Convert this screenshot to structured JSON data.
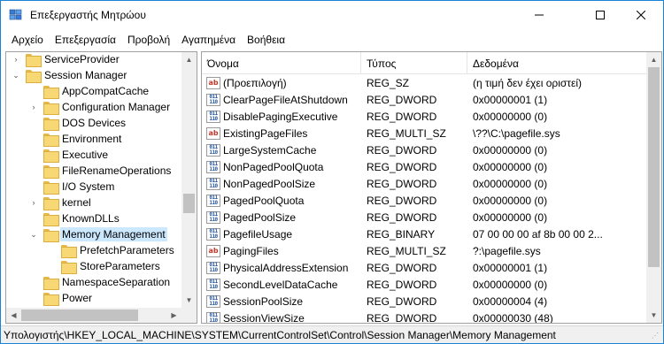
{
  "window": {
    "title": "Επεξεργαστής Μητρώου"
  },
  "menu": [
    "Αρχείο",
    "Επεξεργασία",
    "Προβολή",
    "Αγαπημένα",
    "Βοήθεια"
  ],
  "tree": {
    "items": [
      {
        "label": "ServiceProvider",
        "expander": "›",
        "indent": 1
      },
      {
        "label": "Session Manager",
        "expander": "⌄",
        "indent": 1
      },
      {
        "label": "AppCompatCache",
        "expander": "",
        "indent": 2
      },
      {
        "label": "Configuration Manager",
        "expander": "›",
        "indent": 2
      },
      {
        "label": "DOS Devices",
        "expander": "",
        "indent": 2
      },
      {
        "label": "Environment",
        "expander": "",
        "indent": 2
      },
      {
        "label": "Executive",
        "expander": "",
        "indent": 2
      },
      {
        "label": "FileRenameOperations",
        "expander": "",
        "indent": 2
      },
      {
        "label": "I/O System",
        "expander": "",
        "indent": 2
      },
      {
        "label": "kernel",
        "expander": "›",
        "indent": 2
      },
      {
        "label": "KnownDLLs",
        "expander": "",
        "indent": 2
      },
      {
        "label": "Memory Management",
        "expander": "⌄",
        "indent": 2,
        "selected": true
      },
      {
        "label": "PrefetchParameters",
        "expander": "",
        "indent": 3
      },
      {
        "label": "StoreParameters",
        "expander": "",
        "indent": 3
      },
      {
        "label": "NamespaceSeparation",
        "expander": "",
        "indent": 2
      },
      {
        "label": "Power",
        "expander": "",
        "indent": 2
      }
    ]
  },
  "values": {
    "columns": {
      "name": "Όνομα",
      "type": "Τύπος",
      "data": "Δεδομένα"
    },
    "rows": [
      {
        "icon": "string-value-icon",
        "name": "(Προεπιλογή)",
        "type": "REG_SZ",
        "data": "(η τιμή δεν έχει οριστεί)"
      },
      {
        "icon": "binary-value-icon",
        "name": "ClearPageFileAtShutdown",
        "type": "REG_DWORD",
        "data": "0x00000001 (1)"
      },
      {
        "icon": "binary-value-icon",
        "name": "DisablePagingExecutive",
        "type": "REG_DWORD",
        "data": "0x00000000 (0)"
      },
      {
        "icon": "string-value-icon",
        "name": "ExistingPageFiles",
        "type": "REG_MULTI_SZ",
        "data": "\\??\\C:\\pagefile.sys"
      },
      {
        "icon": "binary-value-icon",
        "name": "LargeSystemCache",
        "type": "REG_DWORD",
        "data": "0x00000000 (0)"
      },
      {
        "icon": "binary-value-icon",
        "name": "NonPagedPoolQuota",
        "type": "REG_DWORD",
        "data": "0x00000000 (0)"
      },
      {
        "icon": "binary-value-icon",
        "name": "NonPagedPoolSize",
        "type": "REG_DWORD",
        "data": "0x00000000 (0)"
      },
      {
        "icon": "binary-value-icon",
        "name": "PagedPoolQuota",
        "type": "REG_DWORD",
        "data": "0x00000000 (0)"
      },
      {
        "icon": "binary-value-icon",
        "name": "PagedPoolSize",
        "type": "REG_DWORD",
        "data": "0x00000000 (0)"
      },
      {
        "icon": "binary-value-icon",
        "name": "PagefileUsage",
        "type": "REG_BINARY",
        "data": "07 00 00 00 af 8b 00 00 2..."
      },
      {
        "icon": "string-value-icon",
        "name": "PagingFiles",
        "type": "REG_MULTI_SZ",
        "data": "?:\\pagefile.sys"
      },
      {
        "icon": "binary-value-icon",
        "name": "PhysicalAddressExtension",
        "type": "REG_DWORD",
        "data": "0x00000001 (1)"
      },
      {
        "icon": "binary-value-icon",
        "name": "SecondLevelDataCache",
        "type": "REG_DWORD",
        "data": "0x00000000 (0)"
      },
      {
        "icon": "binary-value-icon",
        "name": "SessionPoolSize",
        "type": "REG_DWORD",
        "data": "0x00000004 (4)"
      },
      {
        "icon": "binary-value-icon",
        "name": "SessionViewSize",
        "type": "REG_DWORD",
        "data": "0x00000030 (48)"
      }
    ]
  },
  "status": {
    "path": "Υπολογιστής\\HKEY_LOCAL_MACHINE\\SYSTEM\\CurrentControlSet\\Control\\Session Manager\\Memory Management"
  },
  "colors": {
    "selection": "#cce8ff",
    "folder": "#f8d775",
    "window_border": "#1883d7"
  }
}
